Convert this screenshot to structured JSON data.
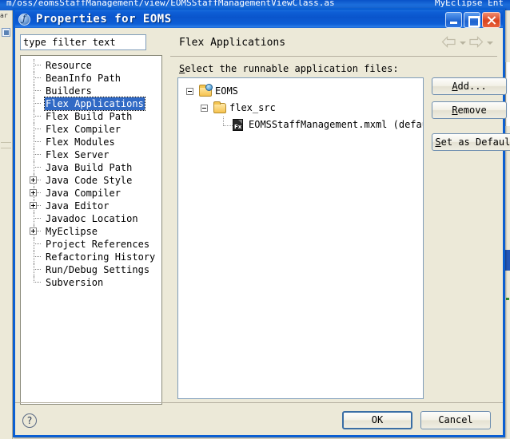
{
  "background": {
    "titlebar_text": "m/oss/eomsStaffManagement/view/EOMSStaffManagementViewClass.as",
    "titlebar_right": "MyEclipse Ent",
    "tab_label": "ar"
  },
  "dialog": {
    "title": "Properties for EOMS",
    "window_icon": "eclipse-properties-icon",
    "buttons": {
      "minimize": "minimize-icon",
      "maximize": "maximize-icon",
      "close": "close-icon"
    }
  },
  "filter": {
    "value": "type filter text",
    "placeholder": "type filter text"
  },
  "nav_tree": {
    "items": [
      {
        "label": "Resource",
        "expandable": false,
        "selected": false
      },
      {
        "label": "BeanInfo Path",
        "expandable": false,
        "selected": false
      },
      {
        "label": "Builders",
        "expandable": false,
        "selected": false
      },
      {
        "label": "Flex Applications",
        "expandable": false,
        "selected": true
      },
      {
        "label": "Flex Build Path",
        "expandable": false,
        "selected": false
      },
      {
        "label": "Flex Compiler",
        "expandable": false,
        "selected": false
      },
      {
        "label": "Flex Modules",
        "expandable": false,
        "selected": false
      },
      {
        "label": "Flex Server",
        "expandable": false,
        "selected": false
      },
      {
        "label": "Java Build Path",
        "expandable": false,
        "selected": false
      },
      {
        "label": "Java Code Style",
        "expandable": true,
        "selected": false
      },
      {
        "label": "Java Compiler",
        "expandable": true,
        "selected": false
      },
      {
        "label": "Java Editor",
        "expandable": true,
        "selected": false
      },
      {
        "label": "Javadoc Location",
        "expandable": false,
        "selected": false
      },
      {
        "label": "MyEclipse",
        "expandable": true,
        "selected": false
      },
      {
        "label": "Project References",
        "expandable": false,
        "selected": false
      },
      {
        "label": "Refactoring History",
        "expandable": false,
        "selected": false
      },
      {
        "label": "Run/Debug Settings",
        "expandable": false,
        "selected": false
      },
      {
        "label": "Subversion",
        "expandable": false,
        "selected": false
      }
    ]
  },
  "page": {
    "title": "Flex Applications",
    "nav_back": "back-arrow-icon",
    "nav_forward": "forward-arrow-icon",
    "instruction_accel": "S",
    "instruction_rest": "elect the runnable application files:"
  },
  "app_tree": {
    "rows": [
      {
        "label": "EOMS",
        "icon": "project-folder-icon",
        "expanded": true
      },
      {
        "label": "flex_src",
        "icon": "folder-icon",
        "expanded": true
      },
      {
        "label": "EOMSStaffManagement.mxml (default)",
        "icon": "flex-mxml-file-icon",
        "expanded": false
      }
    ]
  },
  "side_buttons": {
    "add": {
      "accel": "A",
      "rest": "dd..."
    },
    "remove": {
      "accel": "R",
      "rest": "emove"
    },
    "setdefault": {
      "accel": "S",
      "rest": "et as Default"
    }
  },
  "footer": {
    "help": "?",
    "ok": "OK",
    "cancel": "Cancel"
  }
}
